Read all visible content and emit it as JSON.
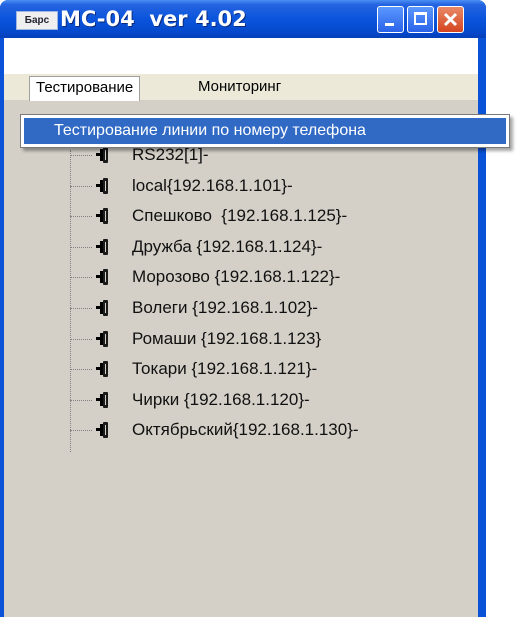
{
  "window": {
    "app_icon_text": "Барс",
    "title": "MC-04  ver 4.02"
  },
  "menubar": {
    "items": [
      {
        "label": "Тестирование"
      },
      {
        "label": "Мониторинг"
      }
    ]
  },
  "dropdown": {
    "items": [
      {
        "label": "Тестирование линии по номеру телефона"
      }
    ]
  },
  "tree": {
    "nodes": [
      {
        "label": "RS232[1]-",
        "icon": "plug-icon"
      },
      {
        "label": "local{192.168.1.101}-",
        "icon": "plug-icon"
      },
      {
        "label": "Спешково  {192.168.1.125}-",
        "icon": "plug-icon"
      },
      {
        "label": "Дружба {192.168.1.124}-",
        "icon": "plug-icon"
      },
      {
        "label": "Морозово {192.168.1.122}-",
        "icon": "plug-icon"
      },
      {
        "label": "Волеги {192.168.1.102}-",
        "icon": "plug-icon"
      },
      {
        "label": "Ромаши {192.168.1.123}",
        "icon": "plug-icon"
      },
      {
        "label": "Токари {192.168.1.121}-",
        "icon": "plug-icon"
      },
      {
        "label": "Чирки {192.168.1.120}-",
        "icon": "plug-icon"
      },
      {
        "label": "Октябрьский{192.168.1.130}-",
        "icon": "plug-icon"
      }
    ]
  }
}
